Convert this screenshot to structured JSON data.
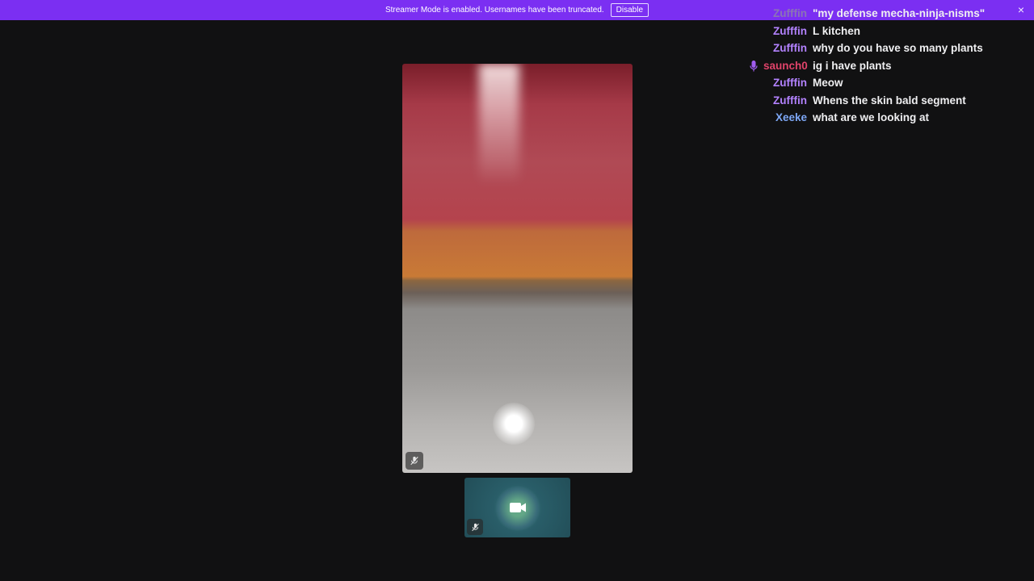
{
  "banner": {
    "text": "Streamer Mode is enabled. Usernames have been truncated.",
    "disable_label": "Disable",
    "close_glyph": "×",
    "color": "#7b2ff2"
  },
  "chat": {
    "messages": [
      {
        "user": "Zufffin",
        "text": "\"my defense mecha-ninja-nisms\"",
        "style": "faded"
      },
      {
        "user": "Zufffin",
        "text": "L kitchen",
        "style": "purple"
      },
      {
        "user": "Zufffin",
        "text": "why do you have so many plants",
        "style": "purple"
      },
      {
        "user": "saunch0",
        "text": "ig i have plants",
        "style": "red",
        "icon": "microphone-icon"
      },
      {
        "user": "Zufffin",
        "text": "Meow",
        "style": "purple"
      },
      {
        "user": "Zufffin",
        "text": "Whens the skin bald segment",
        "style": "purple"
      },
      {
        "user": "Xeeke",
        "text": "what are we looking at",
        "style": "blue"
      }
    ]
  },
  "icons": {
    "main_video_mute": "microphone-muted-icon",
    "thumb_camera": "video-camera-icon",
    "thumb_mute": "microphone-muted-icon"
  }
}
